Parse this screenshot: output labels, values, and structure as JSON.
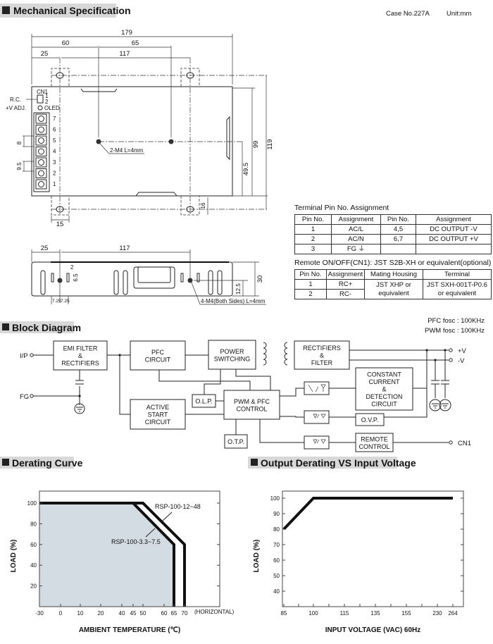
{
  "sections": {
    "mechanical": "Mechanical Specification",
    "block": "Block Diagram",
    "derating": "Derating Curve",
    "output_derating": "Output Derating VS Input Voltage"
  },
  "case_info": {
    "case_no": "Case No.227A",
    "unit": "Unit:mm"
  },
  "top_view": {
    "dims": {
      "overall": "179",
      "d60": "60",
      "d65": "65",
      "d25": "25",
      "d117": "117",
      "h99": "99",
      "h119": "119",
      "h49_5": "49.5",
      "d16": "16",
      "d15": "15",
      "d8": "8",
      "d9_5": "9.5"
    },
    "labels": {
      "cn1": "CN1",
      "rc": "R.C.",
      "vadj": "+V ADJ.",
      "led": "OLED",
      "pin1": "1",
      "pin2": "2",
      "hole_note": "2-M4 L=4mm"
    },
    "terminals": [
      "7",
      "6",
      "5",
      "4",
      "3",
      "2",
      "1"
    ]
  },
  "side_view": {
    "dims": {
      "d25": "25",
      "d117": "117",
      "d2": "2",
      "d6_5": "6.5",
      "h30": "30",
      "h12_5": "12.5",
      "d7_25a": "7.25",
      "d7_25b": "7.25"
    },
    "hole_note": "4-M4(Both Sides) L=4mm"
  },
  "terminal_table": {
    "title": "Terminal Pin No.  Assignment",
    "headers": [
      "Pin No.",
      "Assignment",
      "Pin No.",
      "Assignment"
    ],
    "rows": [
      [
        "1",
        "AC/L",
        "4,5",
        "DC OUTPUT -V"
      ],
      [
        "2",
        "AC/N",
        "6,7",
        "DC OUTPUT +V"
      ],
      [
        "3",
        "FG ⏚",
        "",
        ""
      ]
    ]
  },
  "remote_table": {
    "title": "Remote ON/OFF(CN1): JST S2B-XH or equivalent(optional)",
    "headers": [
      "Pin No.",
      "Assignment",
      "Mating Housing",
      "Terminal"
    ],
    "rows": [
      [
        "1",
        "RC+"
      ],
      [
        "2",
        "RC-"
      ]
    ],
    "housing": "JST XHP or equivalent",
    "terminal": "JST SXH-001T-P0.6 or equivalent"
  },
  "block_diagram": {
    "freq": {
      "pfc": "PFC fosc : 100KHz",
      "pwm": "PWM fosc : 100KHz"
    },
    "terminals": {
      "ip": "I/P",
      "fg": "FG",
      "pv": "+V",
      "nv": "-V",
      "cn1": "CN1"
    },
    "boxes": {
      "emi": [
        "EMI FILTER",
        "&",
        "RECTIFIERS"
      ],
      "pfc": [
        "PFC",
        "CIRCUIT"
      ],
      "psw": [
        "POWER",
        "SWITCHING"
      ],
      "rect": [
        "RECTIFIERS",
        "&",
        "FILTER"
      ],
      "cc": [
        "CONSTANT",
        "CURRENT",
        "&",
        "DETECTION",
        "CIRCUIT"
      ],
      "olp": [
        "O.L.P."
      ],
      "pwm": [
        "PWM & PFC",
        "CONTROL"
      ],
      "active": [
        "ACTIVE",
        "START",
        "CIRCUIT"
      ],
      "ovp": [
        "O.V.P."
      ],
      "remote": [
        "REMOTE",
        "CONTROL"
      ],
      "otp": [
        "O.T.P."
      ]
    }
  },
  "chart_data": [
    {
      "type": "line",
      "title": "Derating Curve",
      "xlabel": "AMBIENT TEMPERATURE (℃)",
      "ylabel": "LOAD (%)",
      "x_ticks": [
        "-30",
        "0",
        "10",
        "20",
        "40",
        "45",
        "50",
        "60",
        "65",
        "70"
      ],
      "x_suffix": "(HORIZONTAL)",
      "y_ticks": [
        "20",
        "40",
        "60",
        "80",
        "100"
      ],
      "ylim": [
        0,
        110
      ],
      "series": [
        {
          "name": "RSP-100-3.3~7.5",
          "points": [
            [
              -30,
              100
            ],
            [
              45,
              100
            ],
            [
              65,
              60
            ],
            [
              65,
              0
            ]
          ],
          "filled": true
        },
        {
          "name": "RSP-100-12~48",
          "points": [
            [
              -30,
              100
            ],
            [
              50,
              100
            ],
            [
              70,
              60
            ],
            [
              70,
              0
            ]
          ]
        }
      ],
      "fill_color": "#d3dbe3"
    },
    {
      "type": "line",
      "title": "Output Derating VS Input Voltage",
      "xlabel": "INPUT VOLTAGE (VAC) 60Hz",
      "ylabel": "LOAD (%)",
      "x_ticks": [
        "85",
        "100",
        "115",
        "135",
        "155",
        "230",
        "264"
      ],
      "y_ticks": [
        "40",
        "50",
        "60",
        "70",
        "80",
        "90",
        "100"
      ],
      "ylim": [
        30,
        105
      ],
      "series": [
        {
          "points": [
            [
              85,
              80
            ],
            [
              100,
              100
            ],
            [
              264,
              100
            ]
          ]
        }
      ]
    }
  ]
}
